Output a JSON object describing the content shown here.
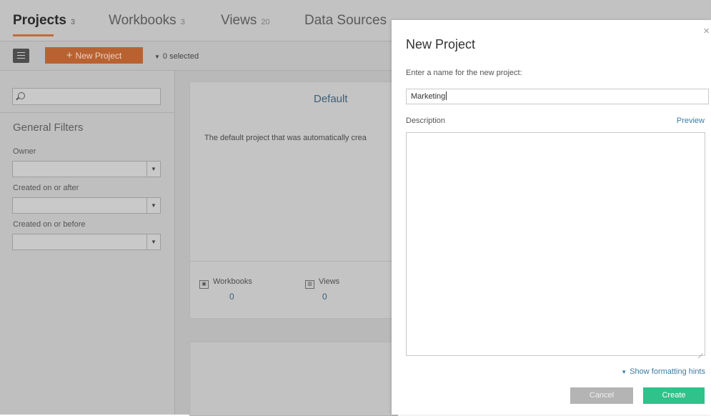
{
  "tabs": [
    {
      "label": "Projects",
      "count": "3"
    },
    {
      "label": "Workbooks",
      "count": "3"
    },
    {
      "label": "Views",
      "count": "20"
    },
    {
      "label": "Data Sources",
      "count": ""
    }
  ],
  "toolbar": {
    "new_project_label": "New Project",
    "selected_label": "0 selected"
  },
  "sidebar": {
    "search": {
      "placeholder": "",
      "value": ""
    },
    "heading": "General Filters",
    "filters": [
      {
        "label": "Owner",
        "value": ""
      },
      {
        "label": "Created on or after",
        "value": ""
      },
      {
        "label": "Created on or before",
        "value": ""
      }
    ]
  },
  "project_card": {
    "title": "Default",
    "description": "The default project that was automatically crea",
    "stats": [
      {
        "label": "Workbooks",
        "value": "0"
      },
      {
        "label": "Views",
        "value": "0"
      }
    ]
  },
  "modal": {
    "title": "New Project",
    "close_glyph": "×",
    "name_prompt": "Enter a name for the new project:",
    "name_value": "Marketing",
    "description_label": "Description",
    "preview_label": "Preview",
    "description_value": "",
    "formatting_hints_label": "Show formatting hints",
    "cancel_label": "Cancel",
    "create_label": "Create"
  },
  "colors": {
    "accent_orange": "#c76a36",
    "create_green": "#2fc28a",
    "link_blue": "#3a7ca5"
  }
}
